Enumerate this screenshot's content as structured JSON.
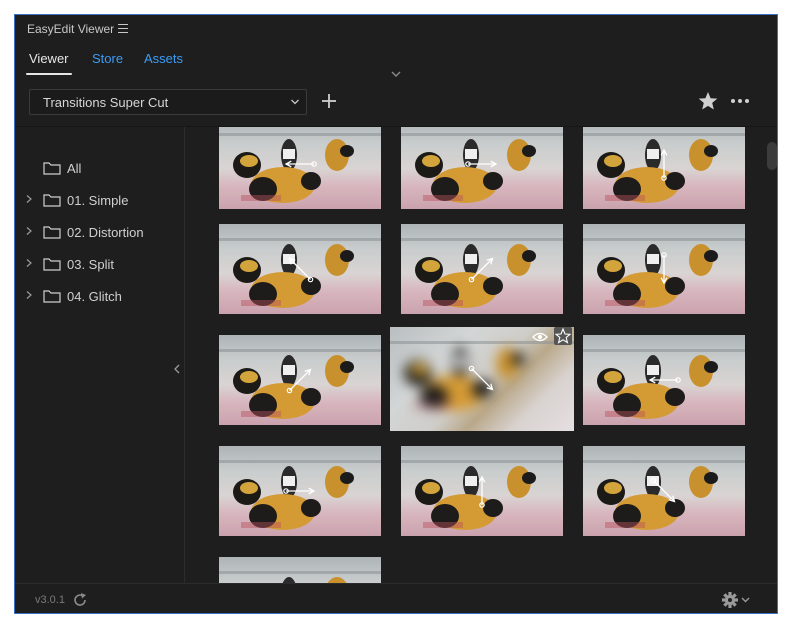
{
  "window": {
    "title": "EasyEdit Viewer"
  },
  "tabs": [
    {
      "label": "Viewer",
      "active": true
    },
    {
      "label": "Store",
      "active": false
    },
    {
      "label": "Assets",
      "active": false
    }
  ],
  "toolbar": {
    "collection_select": "Transitions Super Cut",
    "add_icon": "plus-icon",
    "favorite_icon": "star-icon",
    "more_icon": "more-horizontal-icon"
  },
  "sidebar": {
    "items": [
      {
        "label": "All",
        "expandable": false
      },
      {
        "label": "01. Simple",
        "expandable": true
      },
      {
        "label": "02. Distortion",
        "expandable": true
      },
      {
        "label": "03. Split",
        "expandable": true
      },
      {
        "label": "04. Glitch",
        "expandable": true
      }
    ]
  },
  "grid": {
    "thumbnails": [
      {
        "arrow": "left"
      },
      {
        "arrow": "right"
      },
      {
        "arrow": "up"
      },
      {
        "arrow": "up-left"
      },
      {
        "arrow": "up-right"
      },
      {
        "arrow": "down"
      },
      {
        "arrow": "up-right"
      },
      {
        "arrow": "down-right",
        "hover": true
      },
      {
        "arrow": "left"
      },
      {
        "arrow": "right"
      },
      {
        "arrow": "up"
      },
      {
        "arrow": "down-right"
      },
      {
        "arrow": "none"
      }
    ]
  },
  "footer": {
    "version": "v3.0.1"
  },
  "colors": {
    "accent": "#3b9cf5",
    "background": "#1e1e1e",
    "border": "#3a6fc4"
  }
}
